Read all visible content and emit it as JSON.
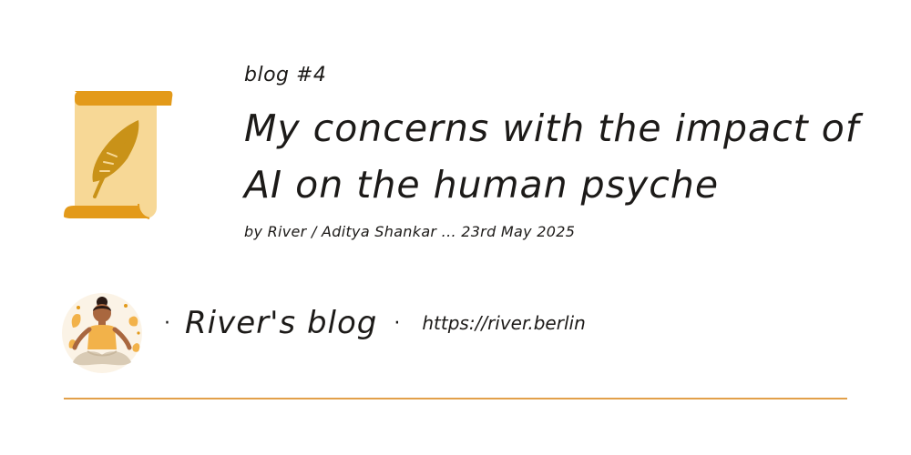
{
  "post": {
    "label": "blog #4",
    "title": "My concerns with the impact of AI on the human psyche",
    "byline": "by River / Aditya Shankar ... 23rd May 2025"
  },
  "footer": {
    "blog_name": "River's blog",
    "blog_url": "https://river.berlin",
    "separator": "·"
  },
  "icons": {
    "post_icon": "scroll-feather-icon",
    "avatar": "meditating-person-avatar"
  },
  "colors": {
    "accent": "#e39a1a",
    "scroll_body": "#f7d896",
    "feather": "#c99218",
    "divider": "#e2a04a"
  }
}
